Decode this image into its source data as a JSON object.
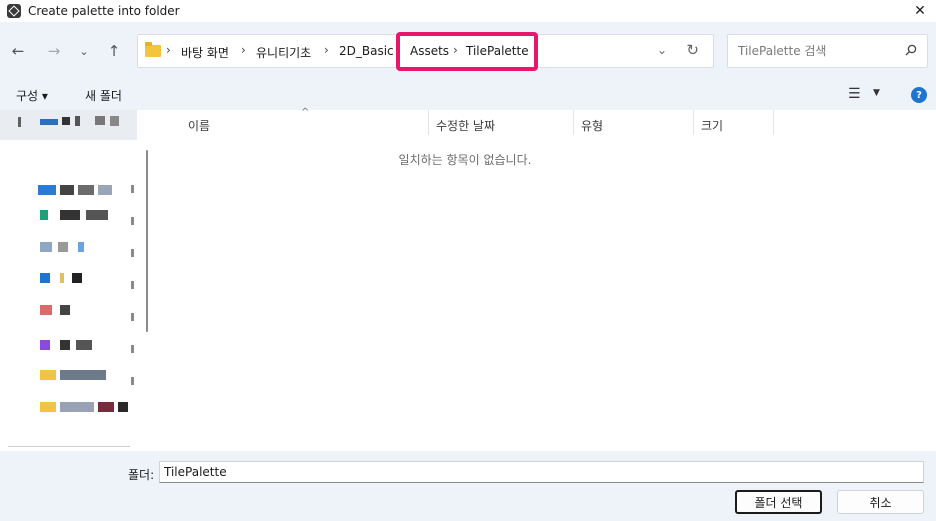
{
  "window": {
    "title": "Create palette into folder"
  },
  "breadcrumb": {
    "items": [
      "바탕 화면",
      "유니티기초",
      "2D_Basic",
      "Assets",
      "TilePalette"
    ]
  },
  "search": {
    "placeholder": "TilePalette 검색"
  },
  "toolbar": {
    "organize_label": "구성 ▾",
    "new_folder_label": "새 폴더",
    "help_label": "?"
  },
  "columns": {
    "name": "이름",
    "date_modified": "수정한 날짜",
    "type": "유형",
    "size": "크기"
  },
  "content": {
    "empty_message": "일치하는 항목이 없습니다."
  },
  "bottom": {
    "folder_label": "폴더:",
    "folder_value": "TilePalette",
    "select_button": "폴더 선택",
    "cancel_button": "취소"
  },
  "colors": {
    "highlight": "#e8176b",
    "accent": "#1f74d1",
    "panel": "#eef3fa"
  }
}
